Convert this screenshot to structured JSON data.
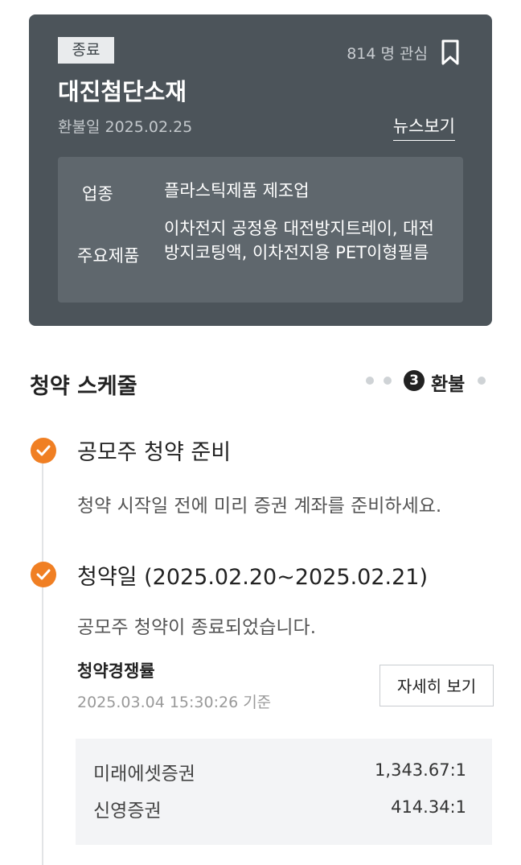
{
  "card": {
    "status_badge": "종료",
    "interest_count": "814 명 관심",
    "company_name": "대진첨단소재",
    "refund_date": "환불일 2025.02.25",
    "news_link": "뉴스보기",
    "industry_label": "업종",
    "industry_value": "플라스틱제품 제조업",
    "products_label": "주요제품",
    "products_value": "이차전지 공정용 대전방지트레이, 대전방지코팅액, 이차전지용 PET이형필름"
  },
  "schedule": {
    "title": "청약 스케줄",
    "current_step_number": "3",
    "current_step_label": "환불",
    "items": [
      {
        "title": "공모주 청약 준비",
        "description": "청약 시작일 전에 미리 증권 계좌를 준비하세요."
      },
      {
        "title": "청약일 (2025.02.20~2025.02.21)",
        "description": "공모주 청약이 종료되었습니다."
      }
    ],
    "competition": {
      "label": "청약경쟁률",
      "timestamp": "2025.03.04 15:30:26 기준",
      "detail_button": "자세히 보기",
      "brokers": [
        {
          "name": "미래에셋증권",
          "ratio": "1,343.67:1"
        },
        {
          "name": "신영증권",
          "ratio": "414.34:1"
        }
      ]
    }
  },
  "colors": {
    "card_bg": "#4c545a",
    "accent_orange": "#f07f23"
  }
}
